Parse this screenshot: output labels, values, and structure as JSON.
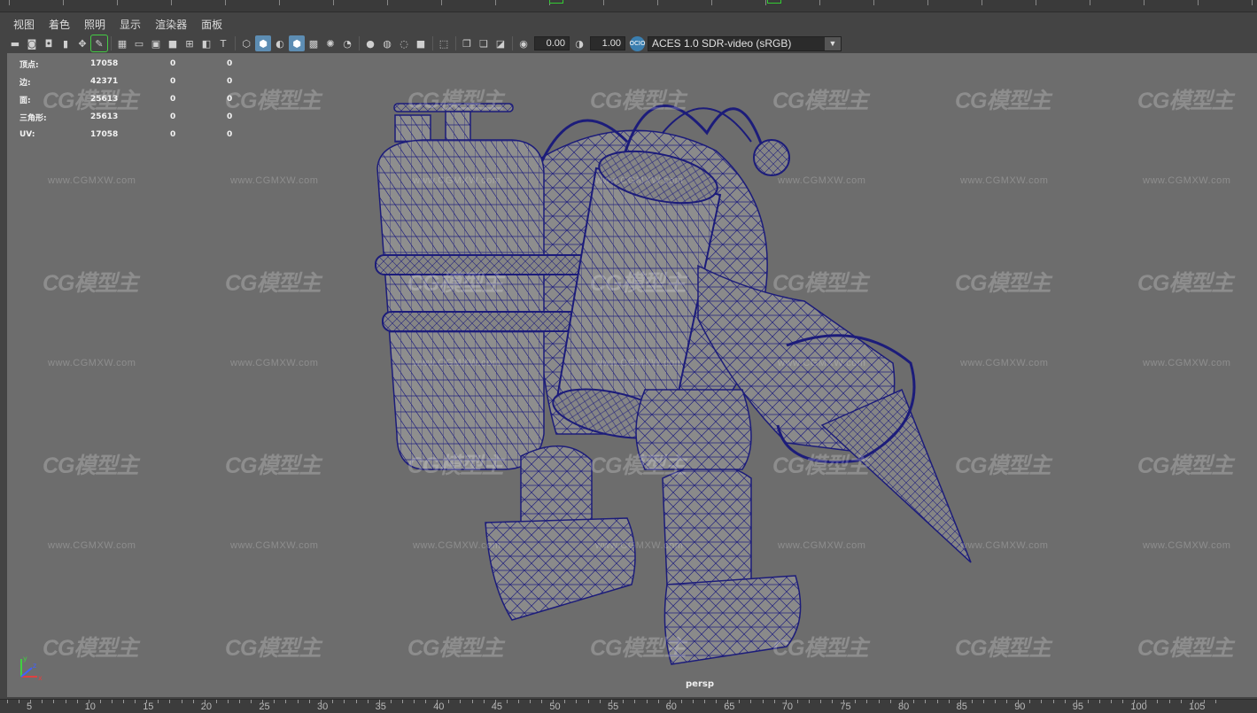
{
  "menu": [
    "视图",
    "着色",
    "照明",
    "显示",
    "渲染器",
    "面板"
  ],
  "toolbar": {
    "icons": [
      "camera-select-icon",
      "camera-attrs-icon",
      "bookmark-icon",
      "image-plane-icon",
      "move-2d-icon",
      "grease-pencil-icon",
      "grid-icon",
      "film-gate-icon",
      "resolution-gate-icon",
      "gate-mask-icon",
      "field-chart-icon",
      "safe-action-icon",
      "wireframe-icon",
      "smooth-shade-icon",
      "wireframe-on-shaded-icon",
      "textured-icon",
      "use-all-lights-icon",
      "shadows-icon",
      "screen-space-ao-icon",
      "motion-blur-icon",
      "multisample-aa-icon",
      "depth-of-field-icon",
      "isolate-select-icon",
      "xray-icon",
      "xray-joints-icon",
      "backface-icon",
      "camera-exposure-icon",
      "camera-gamma-icon",
      "ocio-icon"
    ],
    "exposure_value": "0.00",
    "gamma_value": "1.00",
    "ocio_badge": "OCIO",
    "color_transform": "ACES 1.0 SDR-video (sRGB)"
  },
  "hud": {
    "rows": [
      {
        "label": "顶点:",
        "v1": "17058",
        "v2": "0",
        "v3": "0"
      },
      {
        "label": "边:",
        "v1": "42371",
        "v2": "0",
        "v3": "0"
      },
      {
        "label": "面:",
        "v1": "25613",
        "v2": "0",
        "v3": "0"
      },
      {
        "label": "三角形:",
        "v1": "25613",
        "v2": "0",
        "v3": "0"
      },
      {
        "label": "UV:",
        "v1": "17058",
        "v2": "0",
        "v3": "0"
      }
    ]
  },
  "watermark": {
    "logo": "CG模型主",
    "url": "www.CGMXW.com"
  },
  "camera_label": "persp",
  "axis": {
    "x": "x",
    "y": "y",
    "z": "z"
  },
  "timeline": {
    "numbers": [
      "5",
      "10",
      "15",
      "20",
      "25",
      "30",
      "35",
      "40",
      "45",
      "50",
      "55",
      "60",
      "65",
      "70",
      "75",
      "80",
      "85",
      "90",
      "95",
      "100",
      "105"
    ]
  },
  "colors": {
    "viewport_bg": "#6d6d6d",
    "wireframe": "#1c1c7a",
    "mesh_fill": "#8c8c8c",
    "active_icon": "#5d8db3"
  }
}
